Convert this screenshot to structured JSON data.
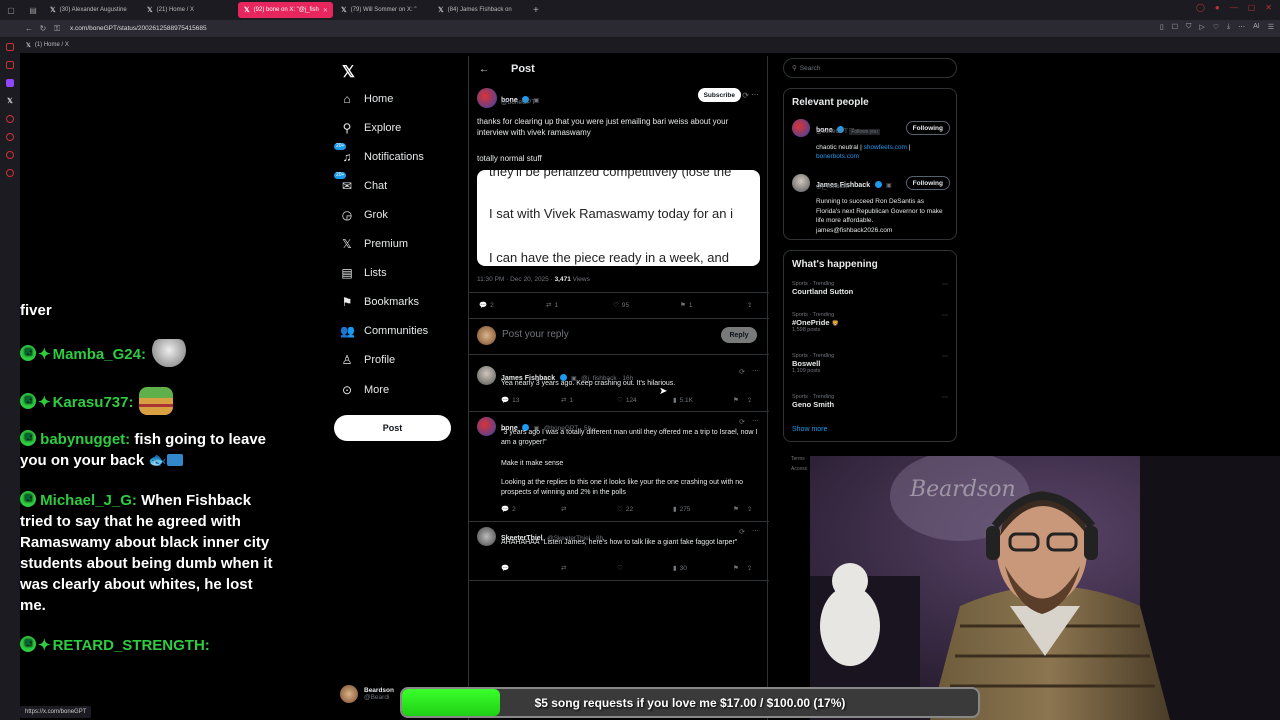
{
  "browser": {
    "tabs": [
      {
        "label": "(30) Alexander Augustine"
      },
      {
        "label": "(21) Home / X"
      },
      {
        "label": "(92) bone on X: \"@j_fish"
      },
      {
        "label": "(79) Will Sommer on X: \""
      },
      {
        "label": "(84) James Fishback on"
      }
    ],
    "url": "x.com/boneGPT/status/2002612588975415685",
    "bookmark": "(1) Home / X",
    "status_url": "https://x.com/boneGPT"
  },
  "chat": {
    "partial_top": "fiver",
    "messages": [
      {
        "user": "Mamba_G24:",
        "text": ""
      },
      {
        "user": "Karasu737:",
        "text": ""
      },
      {
        "user": "babynugget:",
        "text": "fish going to leave you on your back"
      },
      {
        "user": "Michael_J_G:",
        "text": "When Fishback tried to say that he agreed with Ramaswamy about black inner city students about being dumb when it was clearly about whites, he lost me."
      },
      {
        "user": "RETARD_STRENGTH:",
        "text": ""
      }
    ]
  },
  "nav": {
    "items": [
      {
        "label": "Home",
        "icon": "home-icon"
      },
      {
        "label": "Explore",
        "icon": "search-icon"
      },
      {
        "label": "Notifications",
        "icon": "bell-icon",
        "badge": "20+"
      },
      {
        "label": "Chat",
        "icon": "mail-icon",
        "badge": "20+"
      },
      {
        "label": "Grok",
        "icon": "grok-icon"
      },
      {
        "label": "Premium",
        "icon": "x-icon"
      },
      {
        "label": "Lists",
        "icon": "list-icon"
      },
      {
        "label": "Bookmarks",
        "icon": "bookmark-icon"
      },
      {
        "label": "Communities",
        "icon": "people-icon"
      },
      {
        "label": "Profile",
        "icon": "person-icon"
      },
      {
        "label": "More",
        "icon": "more-icon"
      }
    ],
    "post_button": "Post"
  },
  "post": {
    "header_title": "Post",
    "author": "bone",
    "handle": "@boneGPT",
    "subscribe": "Subscribe",
    "text": "thanks for clearing up that you were just emailing bari weiss about your interview with vivek ramaswamy",
    "text2": "totally normal stuff",
    "media_lines": [
      "they'll be penalized competitively (lose the",
      "I sat with Vivek Ramaswamy today for an i",
      "I can have the piece ready in a week, and"
    ],
    "timestamp": "11:30 PM · Dec 20, 2025 · ",
    "views_count": "3,471",
    "views_label": " Views",
    "stats": {
      "replies": "2",
      "reposts": "1",
      "likes": "95",
      "bookmarks": "1"
    },
    "reply_placeholder": "Post your reply",
    "reply_button": "Reply"
  },
  "replies": [
    {
      "name": "James Fishback",
      "handle": "@j_fishback · 16h",
      "text": "Yea nearly 3 years ago. Keep crashing out. It's hilarious.",
      "stats": {
        "replies": "13",
        "reposts": "1",
        "likes": "124",
        "views": "5.1K"
      }
    },
    {
      "name": "bone",
      "handle": "@boneGPT · 5h",
      "text": "\"3 years ago I was a totally different man until they offered me a trip to Israel, now I am a groyper!\"",
      "text2": "Make it make sense",
      "text3": "Looking at the replies to this one it looks like your the one crashing out with no prospects of winning and 2% in the polls",
      "stats": {
        "replies": "2",
        "reposts": "",
        "likes": "22",
        "views": "275"
      }
    },
    {
      "name": "SkeeterThiel",
      "handle": "@SkeeterThiel · 8h",
      "text": "AHAHAHAA \"Listen James, here's how to talk like a giant fake faggot larper\"",
      "stats": {
        "replies": "",
        "reposts": "",
        "likes": "",
        "views": "30"
      }
    }
  ],
  "right": {
    "search_placeholder": "Search",
    "relevant_title": "Relevant people",
    "people": [
      {
        "name": "bone",
        "handle": "@boneGPT",
        "follows_you": "Follows you",
        "button": "Following",
        "bio": "chaotic neutral | ",
        "bio_link1": "showfeets.com",
        "bio_sep": " |",
        "bio_link2": "bonerbots.com"
      },
      {
        "name": "James Fishback",
        "handle": "@j_fishback",
        "button": "Following",
        "bio": "Running to succeed Ron DeSantis as Florida's next Republican Governor to make life more affordable. james@fishback2026.com"
      }
    ],
    "happening_title": "What's happening",
    "trends": [
      {
        "category": "Sports · Trending",
        "name": "Courtland Sutton",
        "count": ""
      },
      {
        "category": "Sports · Trending",
        "name": "#OnePride",
        "count": "1,598 posts"
      },
      {
        "category": "Sports · Trending",
        "name": "Boswell",
        "count": "1,109 posts"
      },
      {
        "category": "Sports · Trending",
        "name": "Geno Smith",
        "count": ""
      }
    ],
    "show_more": "Show more",
    "footer1": "Terms",
    "footer2": "Access"
  },
  "profile_chip": {
    "name": "Beardson",
    "handle": "@Beardi"
  },
  "donation": {
    "label": "$5 song requests if you love me $17.00 / $100.00 (17%)",
    "progress": 0.17
  }
}
